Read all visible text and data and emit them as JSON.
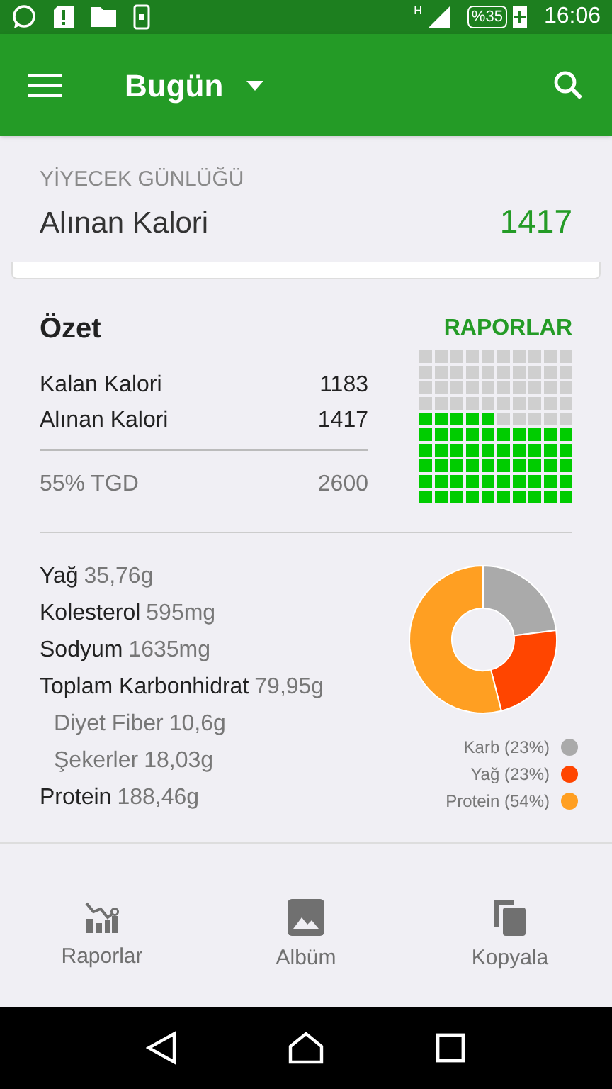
{
  "status_bar": {
    "network": "H",
    "battery": "%35",
    "time": "16:06"
  },
  "app_bar": {
    "title": "Bugün"
  },
  "diary": {
    "caption": "YİYECEK GÜNLÜĞÜ",
    "label": "Alınan Kalori",
    "value": "1417"
  },
  "summary": {
    "title": "Özet",
    "link": "RAPORLAR",
    "rows": [
      {
        "label": "Kalan Kalori",
        "value": "1183",
        "kind": "main"
      },
      {
        "label": "Alınan Kalori",
        "value": "1417",
        "kind": "main"
      },
      {
        "label": "55% TGD",
        "value": "2600",
        "kind": "total"
      }
    ],
    "waffle": {
      "kind": "squares"
    }
  },
  "nutrients": [
    {
      "name": "Yağ",
      "value": "35,76g",
      "kind": "main"
    },
    {
      "name": "Kolesterol",
      "value": "595mg",
      "kind": "main"
    },
    {
      "name": "Sodyum",
      "value": "1635mg",
      "kind": "main"
    },
    {
      "name": "Toplam Karbonhidrat",
      "value": "79,95g",
      "kind": "main"
    },
    {
      "name": "Diyet Fiber",
      "value": "10,6g",
      "kind": "sub"
    },
    {
      "name": "Şekerler",
      "value": "18,03g",
      "kind": "sub"
    },
    {
      "name": "Protein",
      "value": "188,46g",
      "kind": "main"
    }
  ],
  "macros": {
    "chart_data": {
      "type": "donut",
      "values": [
        23,
        23,
        54
      ]
    },
    "legend": [
      {
        "label": "Karb (23%)",
        "color": "#aaaaaa"
      },
      {
        "label": "Yağ (23%)",
        "color": "#ff4500"
      },
      {
        "label": "Protein (54%)",
        "color": "#ff9f22"
      }
    ]
  },
  "bottom_nav": [
    {
      "label": "Raporlar",
      "kind": "reports"
    },
    {
      "label": "Albüm",
      "kind": "album"
    },
    {
      "label": "Kopyala",
      "kind": "copy"
    }
  ]
}
